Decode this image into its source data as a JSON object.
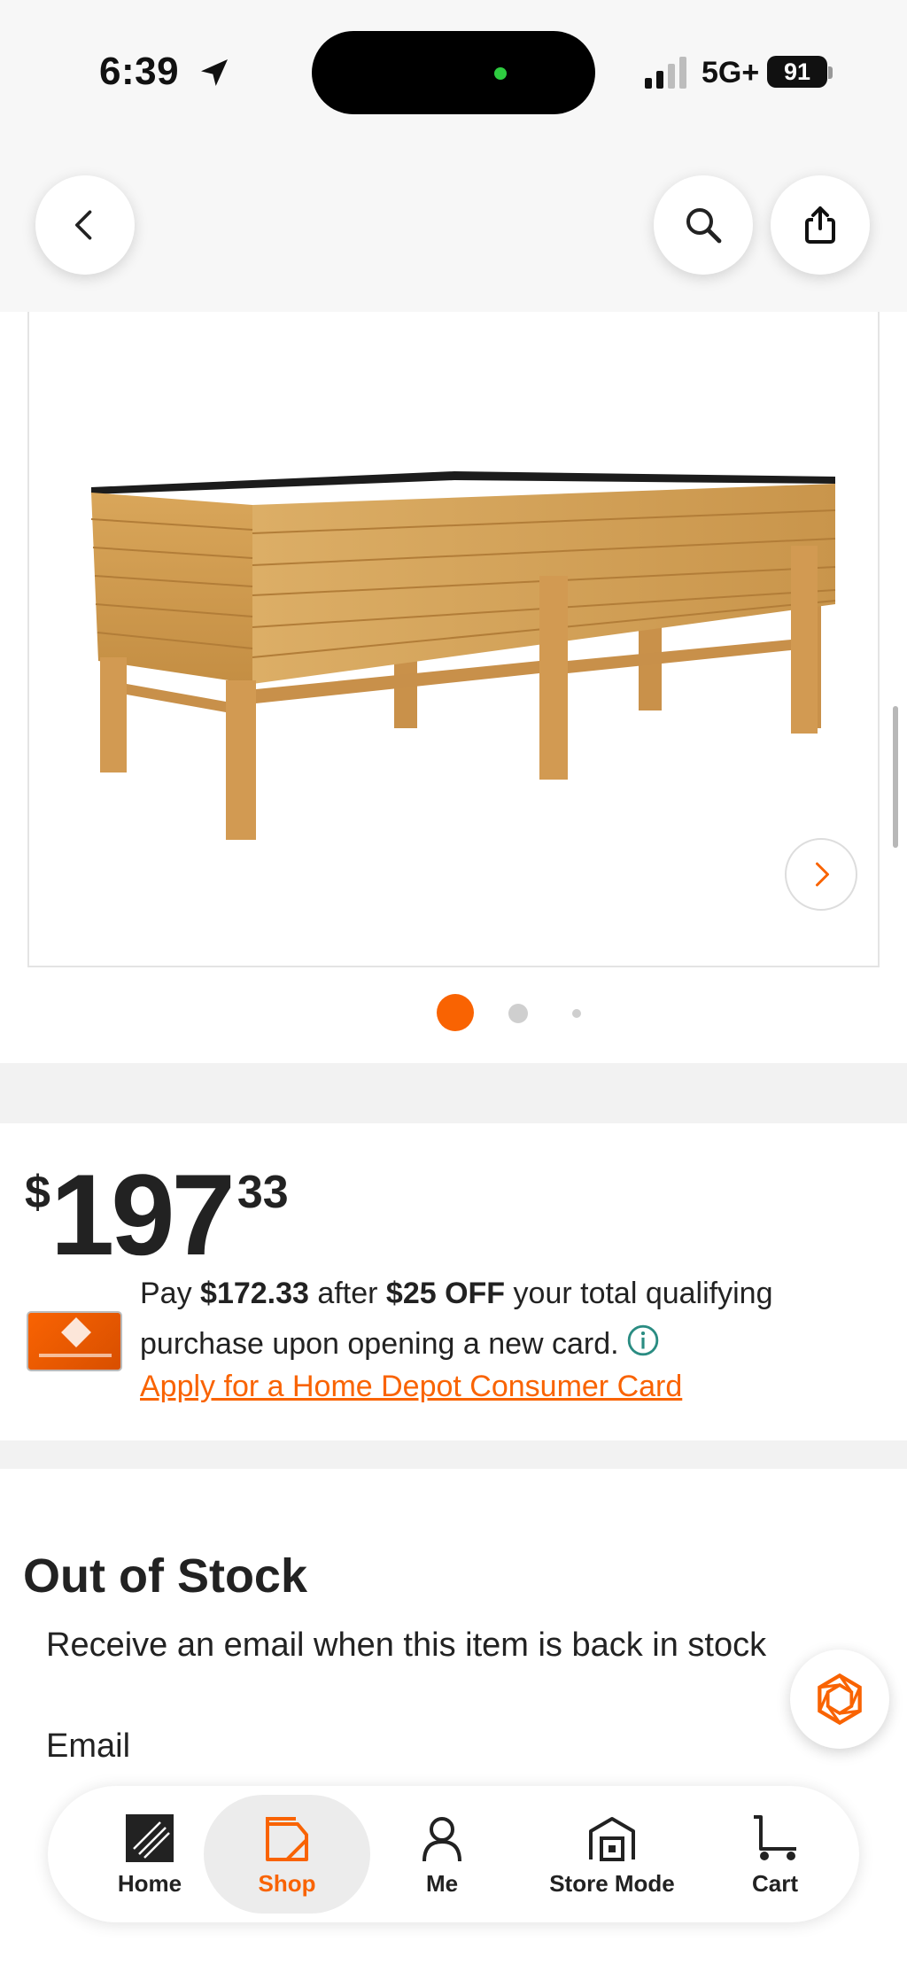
{
  "status_bar": {
    "time": "6:39",
    "network": "5G+",
    "battery": "91"
  },
  "header": {
    "back_icon": "chevron-left-icon",
    "search_icon": "search-icon",
    "share_icon": "share-icon"
  },
  "gallery": {
    "image_description": "wooden raised garden bed",
    "total_images": 3,
    "active_index": 0
  },
  "price": {
    "currency": "$",
    "dollars": "197",
    "cents": "33"
  },
  "promo": {
    "pay": "Pay",
    "discounted_price": "$172.33",
    "after": "after",
    "discount": "$25 OFF",
    "rest": "your total qualifying purchase upon opening a new card.",
    "apply_link": "Apply for a Home Depot Consumer Card"
  },
  "stock": {
    "title": "Out of Stock",
    "message": "Receive an email when this item is back in stock",
    "email_label": "Email"
  },
  "tabbar": {
    "items": [
      {
        "label": "Home",
        "icon": "home-depot-logo-icon"
      },
      {
        "label": "Shop",
        "icon": "shop-bag-icon"
      },
      {
        "label": "Me",
        "icon": "person-icon"
      },
      {
        "label": "Store Mode",
        "icon": "store-icon"
      },
      {
        "label": "Cart",
        "icon": "cart-icon"
      }
    ]
  },
  "colors": {
    "accent": "#f96302",
    "info": "#2a8c82"
  }
}
